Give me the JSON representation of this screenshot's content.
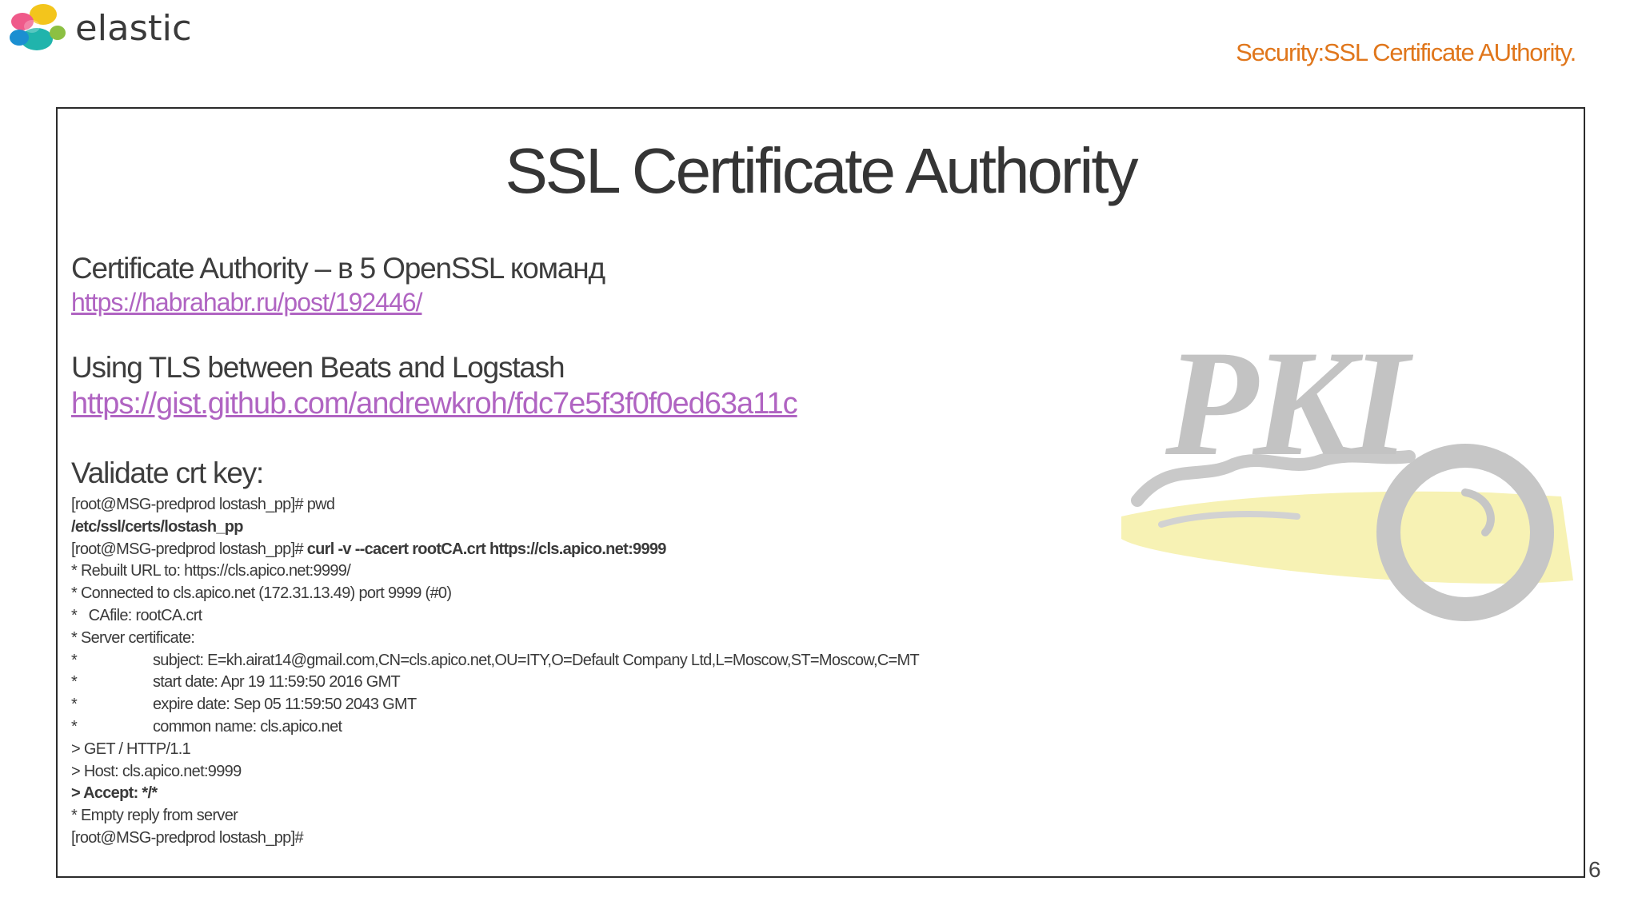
{
  "header": {
    "logo_text": "elastic",
    "section_title": "Security:SSL Certificate AUthority."
  },
  "slide": {
    "heading": "SSL Certificate Authority",
    "items": [
      {
        "title": "Certificate Authority – в 5 OpenSSL команд",
        "link": "https://habrahabr.ru/post/192446/"
      },
      {
        "title": "Using TLS between Beats and Logstash",
        "link": "https://gist.github.com/andrewkroh/fdc7e5f3f0f0ed63a11c"
      }
    ],
    "validate_title": "Validate crt key:",
    "terminal": {
      "line1": "[root@MSG-predprod lostash_pp]# pwd",
      "line2": "/etc/ssl/certs/lostash_pp",
      "line3_prompt": "[root@MSG-predprod lostash_pp]# ",
      "line3_cmd": "curl -v --cacert rootCA.crt https://cls.apico.net:9999",
      "line4": "* Rebuilt URL to: https://cls.apico.net:9999/",
      "line5": "* Connected to cls.apico.net (172.31.13.49) port 9999 (#0)",
      "line6": "*   CAfile: rootCA.crt",
      "line7": "* Server certificate:",
      "line8": "subject: E=kh.airat14@gmail.com,CN=cls.apico.net,OU=ITY,O=Default Company Ltd,L=Moscow,ST=Moscow,C=MT",
      "line9": "start date: Apr 19 11:59:50 2016 GMT",
      "line10": "expire date: Sep 05 11:59:50 2043 GMT",
      "line11": "common name: cls.apico.net",
      "line12": "> GET / HTTP/1.1",
      "line13": "> Host: cls.apico.net:9999",
      "line14": "> Accept: */*",
      "line15": "* Empty reply from server",
      "line16": "[root@MSG-predprod lostash_pp]#",
      "bullet": "*"
    },
    "pki_graphic_text": "PKI",
    "page_number": "6"
  },
  "colors": {
    "accent_orange": "#e0761b",
    "link_purple": "#b064c2",
    "key_yellow": "#f7f1b0",
    "pki_gray": "#c8c8c8"
  },
  "icons": [
    "elastic-logo-icon",
    "pki-key-illustration"
  ]
}
